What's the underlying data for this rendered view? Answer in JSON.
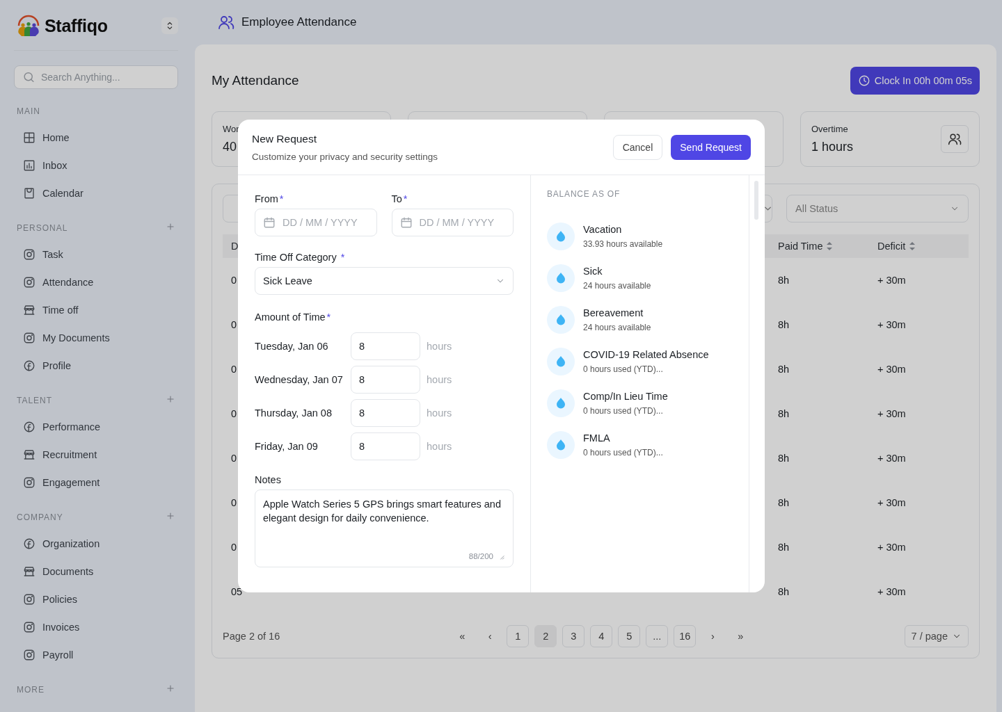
{
  "brand": {
    "name": "Staffiqo"
  },
  "search": {
    "placeholder": "Search Anything..."
  },
  "sidebar": {
    "sections": [
      {
        "title": "MAIN",
        "addable": false,
        "items": [
          {
            "label": "Home",
            "kind": "grid"
          },
          {
            "label": "Inbox",
            "kind": "chart"
          },
          {
            "label": "Calendar",
            "kind": "bag"
          }
        ]
      },
      {
        "title": "PERSONAL",
        "addable": true,
        "items": [
          {
            "label": "Task",
            "kind": "camera"
          },
          {
            "label": "Attendance",
            "kind": "camera"
          },
          {
            "label": "Time off",
            "kind": "store"
          },
          {
            "label": "My Documents",
            "kind": "camera"
          },
          {
            "label": "Profile",
            "kind": "fcircle"
          }
        ]
      },
      {
        "title": "TALENT",
        "addable": true,
        "items": [
          {
            "label": "Performance",
            "kind": "fcircle"
          },
          {
            "label": "Recruitment",
            "kind": "store"
          },
          {
            "label": "Engagement",
            "kind": "camera"
          }
        ]
      },
      {
        "title": "COMPANY",
        "addable": true,
        "items": [
          {
            "label": "Organization",
            "kind": "fcircle"
          },
          {
            "label": "Documents",
            "kind": "store"
          },
          {
            "label": "Policies",
            "kind": "camera"
          },
          {
            "label": "Invoices",
            "kind": "camera"
          },
          {
            "label": "Payroll",
            "kind": "camera"
          }
        ]
      },
      {
        "title": "MORE",
        "addable": true
      }
    ]
  },
  "header": {
    "title": "Employee Attendance"
  },
  "page": {
    "title": "My Attendance",
    "clock_button": "Clock In 00h 00m 05s"
  },
  "stats": [
    {
      "label": "Wor",
      "value": "40"
    },
    {
      "label": "Overtime",
      "value": "1 hours",
      "action": true
    }
  ],
  "filters": {
    "status": "All Status"
  },
  "table": {
    "columns": [
      {
        "label": "D",
        "sortable": false
      },
      {
        "label": "Paid Time",
        "sortable": true
      },
      {
        "label": "Deficit",
        "sortable": true
      }
    ],
    "rows": [
      {
        "column_1": "0",
        "paid_time": "8h",
        "deficit": "+ 30m"
      },
      {
        "column_1": "0",
        "paid_time": "8h",
        "deficit": "+ 30m"
      },
      {
        "column_1": "0",
        "paid_time": "8h",
        "deficit": "+ 30m"
      },
      {
        "column_1": "0",
        "paid_time": "8h",
        "deficit": "+ 30m"
      },
      {
        "column_1": "0",
        "paid_time": "8h",
        "deficit": "+ 30m"
      },
      {
        "column_1": "0",
        "paid_time": "8h",
        "deficit": "+ 30m"
      },
      {
        "column_1": "0",
        "paid_time": "8h",
        "deficit": "+ 30m"
      },
      {
        "column_1": "05",
        "paid_time": "8h",
        "deficit": "+ 30m"
      }
    ]
  },
  "pagination": {
    "summary": "Page 2 of 16",
    "first": "«",
    "prev": "‹",
    "pages": [
      {
        "label": "1",
        "selected": false
      },
      {
        "label": "2",
        "selected": true
      },
      {
        "label": "3",
        "selected": false
      },
      {
        "label": "4",
        "selected": false
      },
      {
        "label": "5",
        "selected": false
      },
      {
        "label": "...",
        "selected": false
      },
      {
        "label": "16",
        "selected": false
      }
    ],
    "next": "›",
    "last": "»",
    "page_size": "7 / page"
  },
  "modal": {
    "title": "New Request",
    "subtitle": "Customize your privacy and security settings",
    "cancel": "Cancel",
    "submit": "Send Request",
    "from": {
      "label": "From",
      "mark": "*",
      "placeholder": "DD / MM / YYYY"
    },
    "to": {
      "label": "To",
      "mark": "*",
      "placeholder": "DD / MM / YYYY"
    },
    "category": {
      "label": "Time Off Category",
      "mark": "*",
      "value": "Sick Leave"
    },
    "amount": {
      "label": "Amount of Time",
      "mark": "*",
      "days": [
        {
          "day": "Tuesday, Jan 06",
          "value": "8",
          "unit": "hours"
        },
        {
          "day": "Wednesday, Jan 07",
          "value": "8",
          "unit": "hours"
        },
        {
          "day": "Thursday, Jan 08",
          "value": "8",
          "unit": "hours"
        },
        {
          "day": "Friday, Jan 09",
          "value": "8",
          "unit": "hours"
        }
      ]
    },
    "notes": {
      "label": "Notes",
      "value": "Apple Watch Series 5 GPS brings smart features and elegant design for daily convenience.",
      "counter": "88/200"
    },
    "balance": {
      "title": "BALANCE AS OF",
      "items": [
        {
          "name": "Vacation",
          "detail": "33.93 hours available"
        },
        {
          "name": "Sick",
          "detail": "24 hours available"
        },
        {
          "name": "Bereavement",
          "detail": "24 hours available"
        },
        {
          "name": "COVID-19 Related Absence",
          "detail": "0 hours used (YTD)..."
        },
        {
          "name": "Comp/In Lieu Time",
          "detail": "0 hours used (YTD)..."
        },
        {
          "name": "FMLA",
          "detail": "0 hours used (YTD)..."
        }
      ]
    }
  }
}
